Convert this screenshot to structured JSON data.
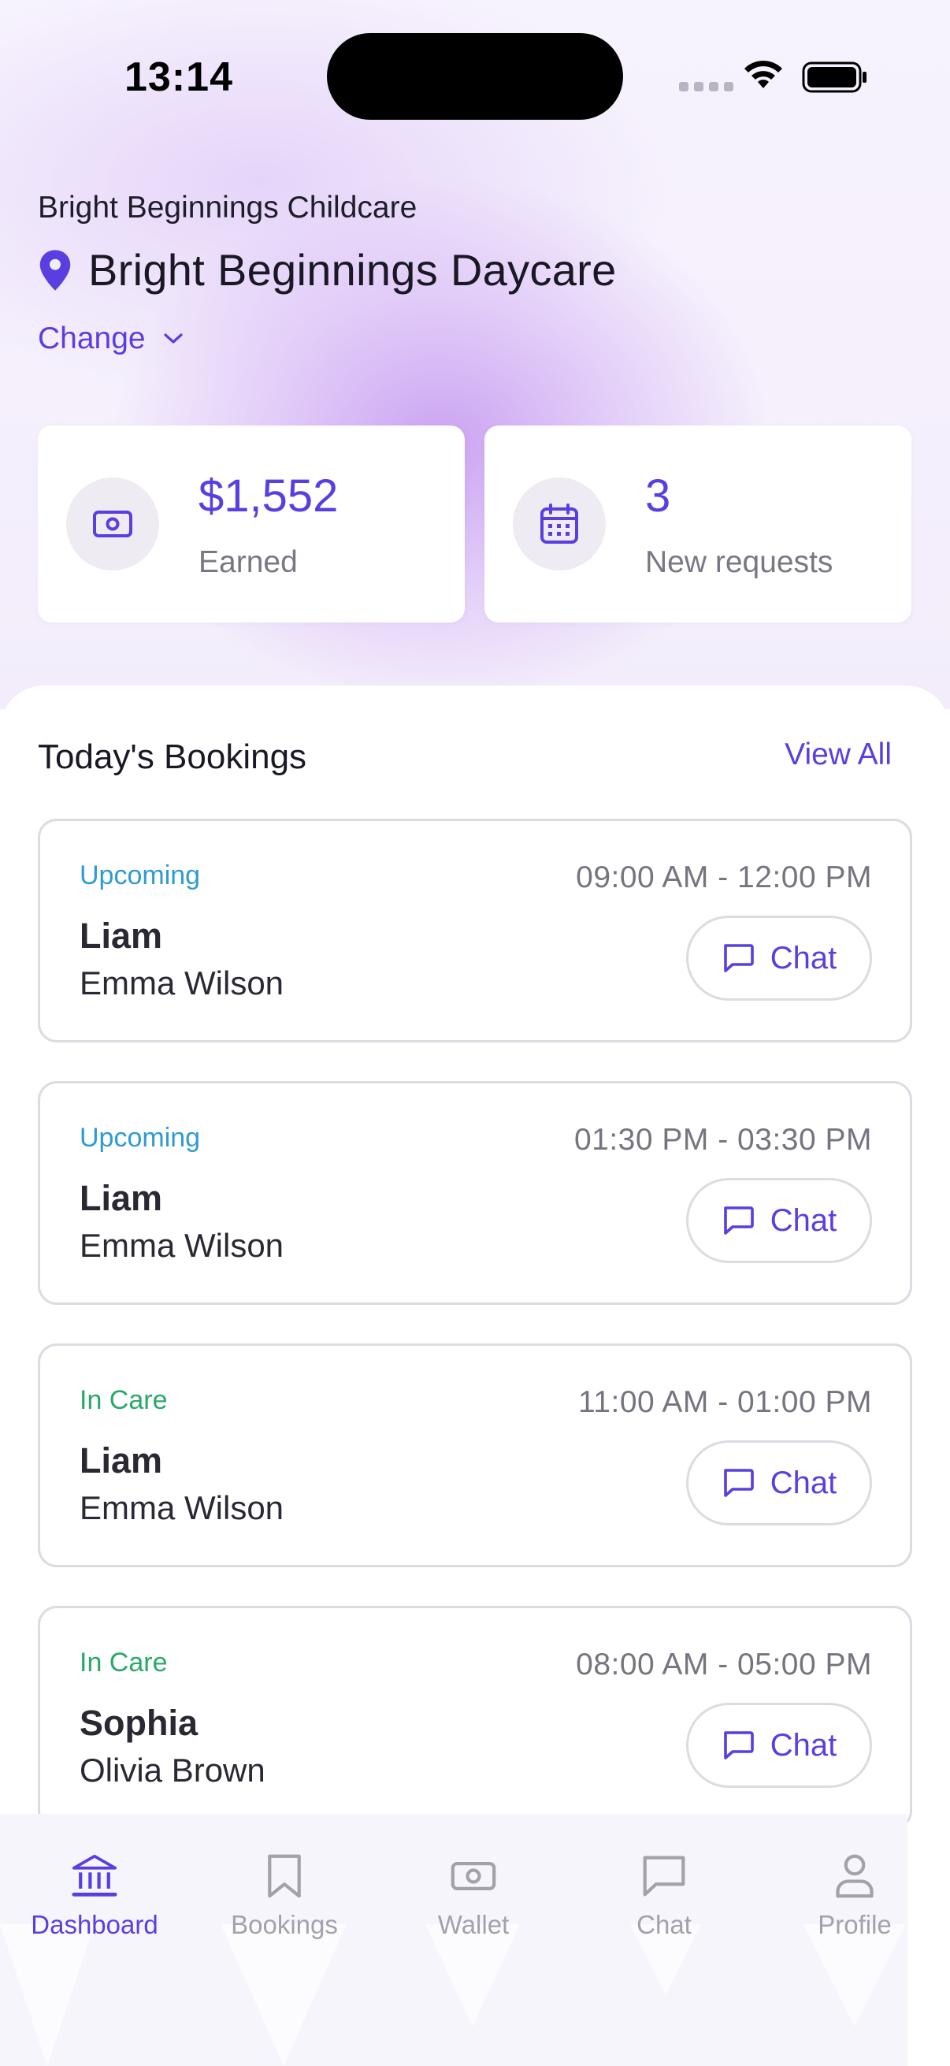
{
  "status_bar": {
    "time": "13:14"
  },
  "header": {
    "org_name": "Bright Beginnings Childcare",
    "location_name": "Bright Beginnings Daycare",
    "change_label": "Change"
  },
  "stats": [
    {
      "value": "$1,552",
      "label": "Earned",
      "icon": "cash-icon"
    },
    {
      "value": "3",
      "label": "New requests",
      "icon": "calendar-icon"
    }
  ],
  "bookings_section": {
    "title": "Today's Bookings",
    "view_all": "View All"
  },
  "bookings": [
    {
      "status": "Upcoming",
      "time": "09:00 AM - 12:00 PM",
      "child": "Liam",
      "parent": "Emma Wilson",
      "chat_label": "Chat"
    },
    {
      "status": "Upcoming",
      "time": "01:30 PM - 03:30 PM",
      "child": "Liam",
      "parent": "Emma Wilson",
      "chat_label": "Chat"
    },
    {
      "status": "In Care",
      "time": "11:00 AM - 01:00 PM",
      "child": "Liam",
      "parent": "Emma Wilson",
      "chat_label": "Chat"
    },
    {
      "status": "In Care",
      "time": "08:00 AM - 05:00 PM",
      "child": "Sophia",
      "parent": "Olivia Brown",
      "chat_label": "Chat"
    }
  ],
  "tabs": [
    {
      "label": "Dashboard",
      "icon": "bank-icon",
      "active": true
    },
    {
      "label": "Bookings",
      "icon": "bookmark-icon",
      "active": false
    },
    {
      "label": "Wallet",
      "icon": "cash-icon",
      "active": false
    },
    {
      "label": "Chat",
      "icon": "chat-bubble-icon",
      "active": false
    },
    {
      "label": "Profile",
      "icon": "person-icon",
      "active": false
    }
  ],
  "colors": {
    "accent": "#5a3ee0",
    "upcoming": "#2f9bd4",
    "in_care": "#2aa86a",
    "muted": "#77747f"
  }
}
